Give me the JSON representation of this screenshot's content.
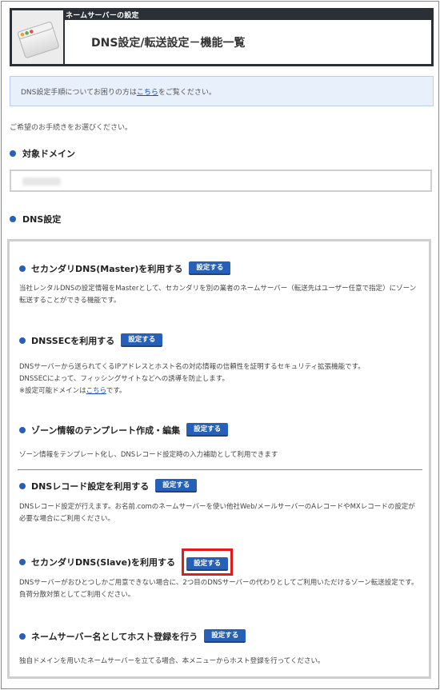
{
  "header": {
    "label": "ネームサーバーの設定",
    "title": "DNS設定/転送設定－機能一覧"
  },
  "notice": {
    "text_before": "DNS設定手順についてお困りの方は",
    "link": "こちら",
    "text_after": "をご覧ください。"
  },
  "prompt": "ご希望のお手続きをお選びください。",
  "domain_section": {
    "heading": "対象ドメイン"
  },
  "dns_section": {
    "heading": "DNS設定"
  },
  "items": [
    {
      "title": "セカンダリDNS(Master)を利用する",
      "button": "設定する",
      "desc": "当社レンタルDNSの設定情報をMasterとして、セカンダリを別の業者のネームサーバー（転送先はユーザー任意で指定）にゾーン転送することができる機能です。"
    },
    {
      "title": "DNSSECを利用する",
      "button": "設定する",
      "desc_line1": "DNSサーバーから送られてくるIPアドレスとホスト名の対応情報の信頼性を証明するセキュリティ拡張機能です。",
      "desc_line2": "DNSSECによって、フィッシングサイトなどへの誘導を防止します。",
      "desc_line3_before": "※設定可能ドメインは",
      "desc_line3_link": "こちら",
      "desc_line3_after": "です。"
    },
    {
      "title": "ゾーン情報のテンプレート作成・編集",
      "button": "設定する",
      "desc": "ゾーン情報をテンプレート化し、DNSレコード設定時の入力補助として利用できます"
    },
    {
      "title": "DNSレコード設定を利用する",
      "button": "設定する",
      "desc": "DNSレコード設定が行えます。お名前.comのネームサーバーを使い他社Web/メールサーバーのAレコードやMXレコードの設定が必要な場合にご利用ください。"
    },
    {
      "title": "セカンダリDNS(Slave)を利用する",
      "button": "設定する",
      "desc": "DNSサーバーがおひとつしかご用意できない場合に、2つ目のDNSサーバーの代わりとしてご利用いただけるゾーン転送設定です。負荷分散対策としてご利用ください。"
    },
    {
      "title": "ネームサーバー名としてホスト登録を行う",
      "button": "設定する",
      "desc": "独自ドメインを用いたネームサーバーを立てる場合、本メニューからホスト登録を行ってください。"
    }
  ]
}
